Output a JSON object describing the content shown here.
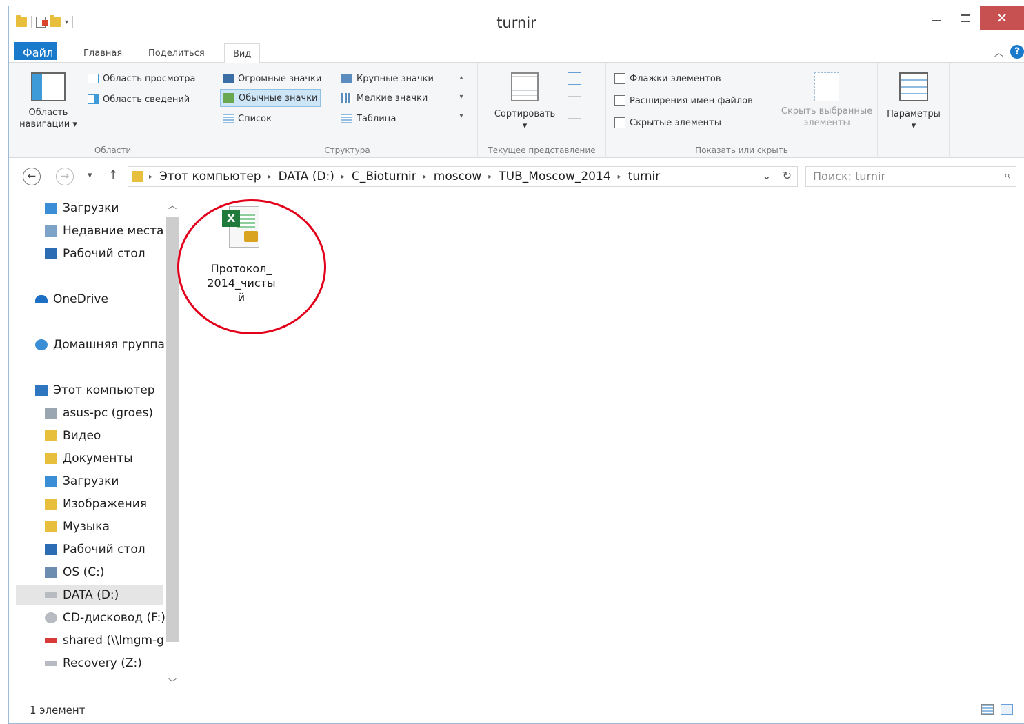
{
  "window": {
    "title": "turnir"
  },
  "tabs": {
    "file": "Файл",
    "home": "Главная",
    "share": "Поделиться",
    "view": "Вид"
  },
  "ribbon": {
    "areas": {
      "nav_pane_line1": "Область",
      "nav_pane_line2": "навигации",
      "preview_pane": "Область просмотра",
      "details_pane": "Область сведений",
      "label": "Области"
    },
    "layout": {
      "huge_icons": "Огромные значки",
      "large_icons": "Крупные значки",
      "normal_icons": "Обычные значки",
      "small_icons": "Мелкие значки",
      "list": "Список",
      "table": "Таблица",
      "label": "Структура"
    },
    "current_view": {
      "sort": "Сортировать",
      "label": "Текущее представление"
    },
    "show_hide": {
      "item_checkboxes": "Флажки элементов",
      "file_extensions": "Расширения имен файлов",
      "hidden_items": "Скрытые элементы",
      "hide_selected_line1": "Скрыть выбранные",
      "hide_selected_line2": "элементы",
      "label": "Показать или скрыть"
    },
    "options": {
      "label": "Параметры"
    }
  },
  "address": {
    "crumbs": [
      "Этот компьютер",
      "DATA (D:)",
      "C_Bioturnir",
      "moscow",
      "TUB_Moscow_2014",
      "turnir"
    ]
  },
  "search": {
    "placeholder": "Поиск: turnir"
  },
  "nav": {
    "items": [
      {
        "label": "Загрузки",
        "icon": "downloads-folder-icon",
        "color": "#3a8ed6"
      },
      {
        "label": "Недавние места",
        "icon": "recent-places-icon",
        "color": "#7ea3c8"
      },
      {
        "label": "Рабочий стол",
        "icon": "desktop-icon",
        "color": "#2b6cb5"
      },
      {
        "label": "OneDrive",
        "icon": "onedrive-icon",
        "color": "#1d6fc4"
      },
      {
        "label": "Домашняя группа",
        "icon": "homegroup-icon",
        "color": "#3a8ed6"
      },
      {
        "label": "Этот компьютер",
        "icon": "this-pc-icon",
        "color": "#2f76c0"
      },
      {
        "label": "asus-pc (groes)",
        "icon": "network-drive-icon",
        "color": "#9aa6b2"
      },
      {
        "label": "Видео",
        "icon": "videos-folder-icon",
        "color": "#e8bf3c"
      },
      {
        "label": "Документы",
        "icon": "documents-folder-icon",
        "color": "#e8bf3c"
      },
      {
        "label": "Загрузки",
        "icon": "downloads-folder-icon",
        "color": "#3a8ed6"
      },
      {
        "label": "Изображения",
        "icon": "pictures-folder-icon",
        "color": "#e8bf3c"
      },
      {
        "label": "Музыка",
        "icon": "music-folder-icon",
        "color": "#e8bf3c"
      },
      {
        "label": "Рабочий стол",
        "icon": "desktop-folder-icon",
        "color": "#2b6cb5"
      },
      {
        "label": "OS (C:)",
        "icon": "system-drive-icon",
        "color": "#6c8cb0"
      },
      {
        "label": "DATA (D:)",
        "icon": "drive-icon",
        "color": "#b8bcc2"
      },
      {
        "label": "CD-дисковод (F:)",
        "icon": "cd-drive-icon",
        "color": "#b8bcc2"
      },
      {
        "label": "shared (\\\\lmgm-g",
        "icon": "disconnected-network-drive-icon",
        "color": "#d83a3a"
      },
      {
        "label": "Recovery (Z:)",
        "icon": "drive-icon",
        "color": "#b8bcc2"
      }
    ]
  },
  "content": {
    "files": [
      {
        "name_line1": "Протокол_",
        "name_line2": "2014_чисты",
        "name_line3": "й",
        "icon": "excel-locked-file-icon"
      }
    ]
  },
  "status": {
    "count": "1 элемент"
  },
  "colors": {
    "accent": "#1979ca",
    "close": "#c75050",
    "highlight_circle": "#e3001b"
  }
}
